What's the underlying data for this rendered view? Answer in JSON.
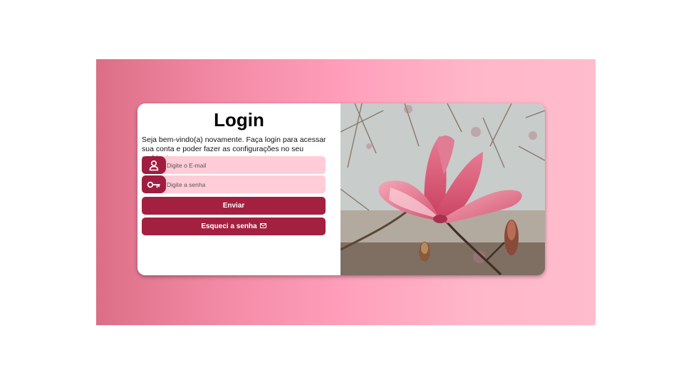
{
  "login": {
    "title": "Login",
    "subtitle": "Seja bem-vindo(a) novamente. Faça login para acessar sua conta e poder fazer as configurações no seu ambiente.",
    "email": {
      "placeholder": "Digite o E-mail",
      "icon": "user-icon"
    },
    "password": {
      "placeholder": "Digite a senha",
      "icon": "key-icon"
    },
    "submit_label": "Enviar",
    "forgot_label": "Esqueci a senha",
    "forgot_icon": "envelope-icon"
  },
  "colors": {
    "accent": "#a32040",
    "input_bg": "#ffccd7",
    "gradient_start": "#dc6f87",
    "gradient_end": "#ffbccc"
  },
  "image": {
    "subject": "magnolia-flower-photo"
  }
}
